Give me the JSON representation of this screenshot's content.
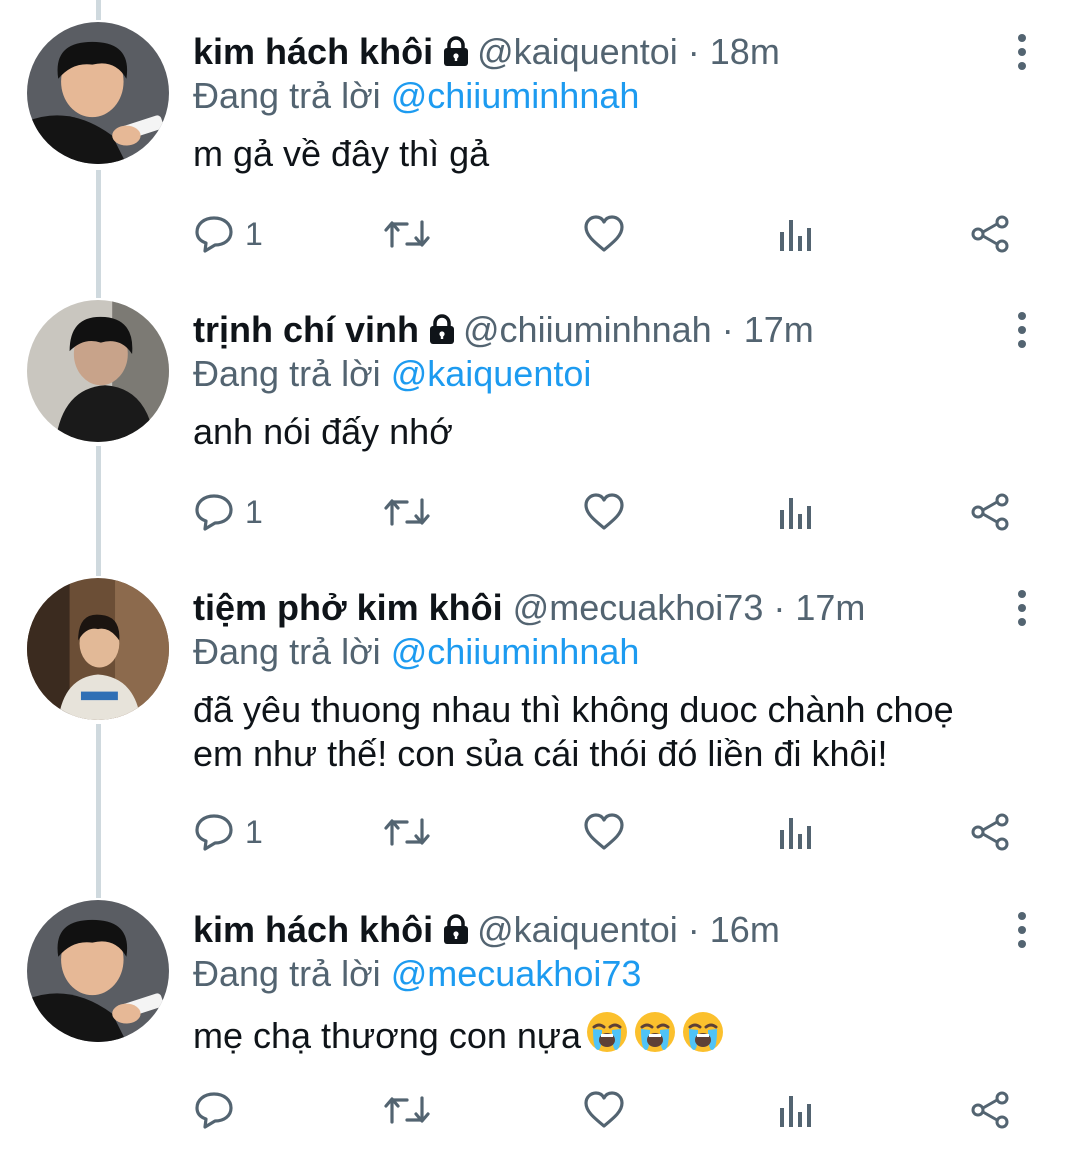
{
  "tweets": [
    {
      "display_name": "kim hách khôi",
      "locked": true,
      "handle": "@kaiquentoi",
      "separator": "·",
      "time": "18m",
      "replying_prefix": "Đang trả lời",
      "replying_to": "@chiiuminhnah",
      "lines": [
        "m gả về đây thì gả"
      ],
      "emojis": [],
      "reply_count": "1",
      "avatar_icon": "boy-with-phone-avatar"
    },
    {
      "display_name": "trịnh chí vinh",
      "locked": true,
      "handle": "@chiiuminhnah",
      "separator": "·",
      "time": "17m",
      "replying_prefix": "Đang trả lời",
      "replying_to": "@kaiquentoi",
      "lines": [
        "anh nói đấy nhớ"
      ],
      "emojis": [],
      "reply_count": "1",
      "avatar_icon": "dark-hair-boy-avatar"
    },
    {
      "display_name": "tiệm phở kim khôi",
      "locked": false,
      "handle": "@mecuakhoi73",
      "separator": "·",
      "time": "17m",
      "replying_prefix": "Đang trả lời",
      "replying_to": "@chiiuminhnah",
      "lines": [
        "đã yêu thuong nhau thì không duoc chành choẹ",
        "em như thế! con sủa cái thói đó liền đi khôi!"
      ],
      "emojis": [],
      "reply_count": "1",
      "avatar_icon": "boy-in-doorway-avatar"
    },
    {
      "display_name": "kim hách khôi",
      "locked": true,
      "handle": "@kaiquentoi",
      "separator": "·",
      "time": "16m",
      "replying_prefix": "Đang trả lời",
      "replying_to": "@mecuakhoi73",
      "lines": [
        "mẹ chạ thương con nựa"
      ],
      "emojis": [
        "loudly-crying-face",
        "loudly-crying-face",
        "loudly-crying-face"
      ],
      "reply_count": "",
      "avatar_icon": "boy-with-phone-avatar"
    }
  ],
  "icons": {
    "reply": "reply-icon",
    "retweet": "retweet-icon",
    "like": "heart-icon",
    "analytics": "analytics-icon",
    "share": "share-icon",
    "more": "more-vertical-icon",
    "lock": "lock-icon"
  },
  "colors": {
    "text_primary": "#0f1419",
    "text_secondary": "#536471",
    "mention": "#1d9bf0",
    "thread_line": "#cfd9de"
  }
}
